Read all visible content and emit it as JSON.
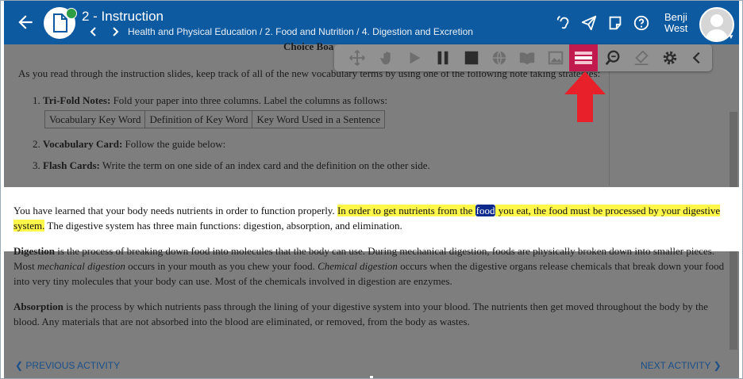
{
  "header": {
    "title": "2 - Instruction",
    "breadcrumb": "Health and Physical Education / 2. Food and Nutrition / 4. Digestion and Excretion",
    "user_first": "Benji",
    "user_last": "West",
    "bg": "#0e5aa0"
  },
  "content": {
    "heading_partial": "Choice Boa",
    "intro": "As you read through the instruction slides, keep track of all of the new vocabulary terms by using one of the following note taking strategies:",
    "item1_num": "1.",
    "item1_label": "Tri-Fold Notes:",
    "item1_text": "Fold your paper into three columns. Label the columns as follows:",
    "columns": [
      "Vocabulary Key Word",
      "Definition of Key Word",
      "Key Word Used in a Sentence"
    ],
    "item2_num": "2.",
    "item2_label": "Vocabulary Card:",
    "item2_text": "Follow the guide below:",
    "item3_num": "3.",
    "item3_label": "Flash Cards:",
    "item3_text": "Write the term on one side of an index card and the definition on the other side."
  },
  "focus": {
    "before": "You have learned that your body needs nutrients in order to function properly.",
    "hl_a": "In order to get nutrients from the",
    "selected": "food",
    "hl_b": "you eat, the food must be processed by your digestive system.",
    "after": "The digestive system has three main functions: digestion, absorption, and elimination."
  },
  "digestion": {
    "term": "Digestion",
    "t1": "is the process of breaking down food into molecules that the body can use. During mechanical digestion, foods are physically broken down into smaller pieces. Most",
    "e1": "mechanical digestion",
    "t2": "occurs in your mouth as you chew your food.",
    "e2": "Chemical digestion",
    "t3": "occurs when the digestive organs release chemicals that break down your food into very tiny molecules that your body can use. Most of the chemicals involved in digestion are enzymes."
  },
  "absorption": {
    "term": "Absorption",
    "text": "is the process by which nutrients pass through the lining of your digestive system into your blood. The nutrients then get moved throughout the body by the blood. Any materials that are not absorbed into the blood are eliminated, or removed, from the body as wastes."
  },
  "footer": {
    "prev": "PREVIOUS ACTIVITY",
    "next": "NEXT ACTIVITY"
  },
  "toolbar_icons": [
    "move-icon",
    "hand-icon",
    "play-icon",
    "pause-icon",
    "stop-icon",
    "globe-icon",
    "book-icon",
    "image-icon",
    "screen-mask-icon",
    "zoom-icon",
    "highlighter-icon",
    "gear-icon",
    "collapse-icon"
  ],
  "colors": {
    "accent": "#0e5aa0",
    "mask_active": "#c21a4f",
    "highlight": "#fff84a",
    "selection": "#0d2a8c",
    "annotation_arrow": "#e8202a"
  }
}
